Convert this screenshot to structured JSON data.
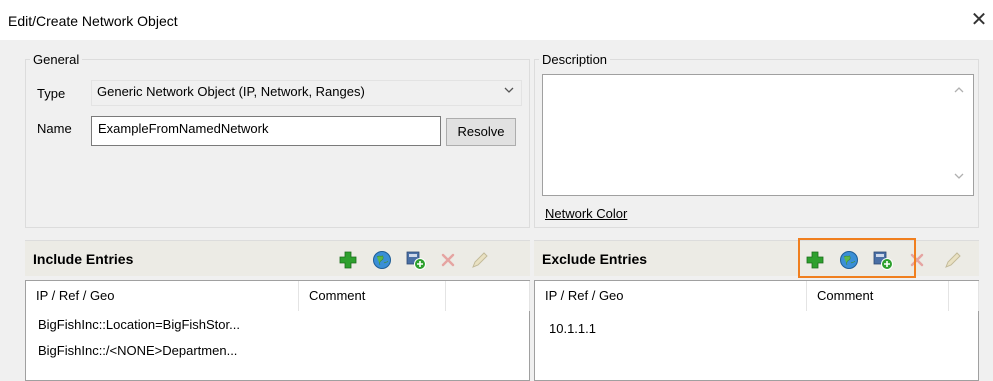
{
  "window": {
    "title": "Edit/Create Network Object"
  },
  "general": {
    "legend": "General",
    "type_label": "Type",
    "type_value": "Generic Network Object (IP, Network, Ranges)",
    "name_label": "Name",
    "name_value": "ExampleFromNamedNetwork",
    "resolve_label": "Resolve"
  },
  "description": {
    "legend": "Description",
    "value": "",
    "network_color_link": "Network Color"
  },
  "include": {
    "title": "Include Entries",
    "columns": [
      "IP / Ref / Geo",
      "Comment"
    ],
    "rows": [
      {
        "ip": "BigFishInc::Location=BigFishStor...",
        "comment": ""
      },
      {
        "ip": "BigFishInc::/<NONE>Departmen...",
        "comment": ""
      }
    ]
  },
  "exclude": {
    "title": "Exclude Entries",
    "columns": [
      "IP / Ref / Geo",
      "Comment"
    ],
    "rows": [
      {
        "ip": "10.1.1.1",
        "comment": ""
      }
    ]
  },
  "toolbar_icons": [
    "add-icon",
    "globe-icon",
    "add-object-icon",
    "delete-icon",
    "edit-icon"
  ],
  "colors": {
    "highlight": "#f07f1f",
    "add": "#2ea02e",
    "delete": "#e05050",
    "header_bg": "#ecebe5"
  }
}
